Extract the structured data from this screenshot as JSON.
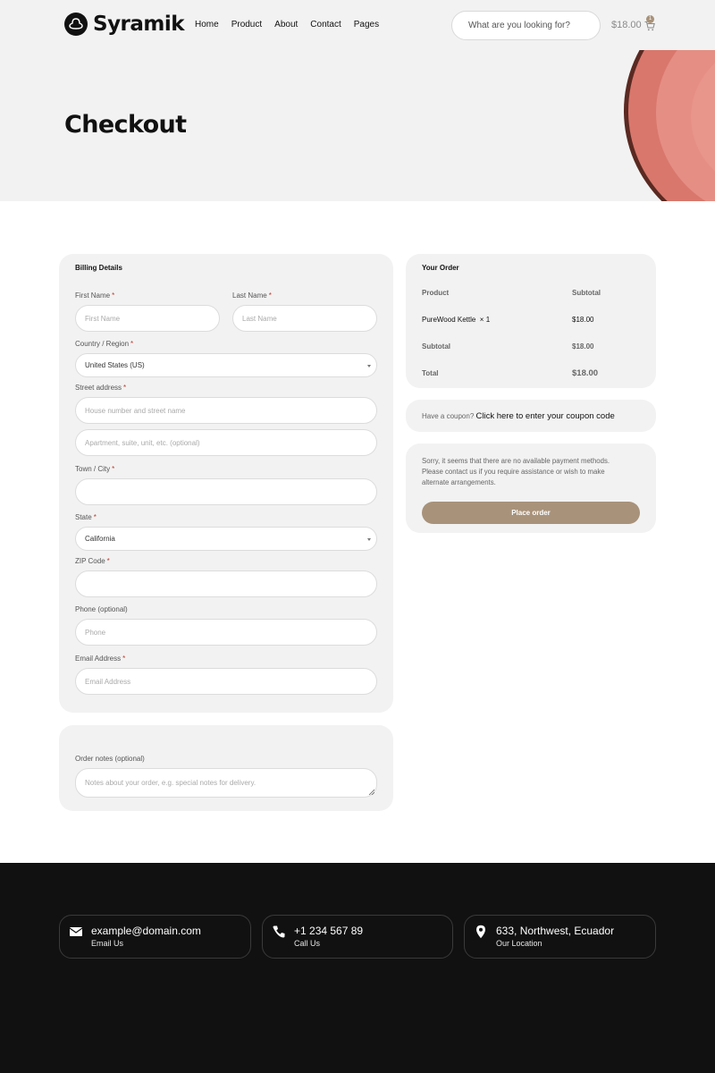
{
  "header": {
    "logo_text": "Syramik",
    "nav": [
      "Home",
      "Product",
      "About",
      "Contact",
      "Pages"
    ],
    "search_placeholder": "What are you looking for?",
    "cart_total": "$18.00",
    "cart_count": "1"
  },
  "hero": {
    "title": "Checkout"
  },
  "billing": {
    "title": "Billing Details",
    "first_name": {
      "label": "First Name",
      "placeholder": "First Name"
    },
    "last_name": {
      "label": "Last Name",
      "placeholder": "Last Name"
    },
    "country": {
      "label": "Country / Region",
      "value": "United States (US)"
    },
    "street": {
      "label": "Street address",
      "placeholder": "House number and street name",
      "placeholder2": "Apartment, suite, unit, etc. (optional)"
    },
    "town": {
      "label": "Town / City",
      "value": ""
    },
    "state": {
      "label": "State",
      "value": "California"
    },
    "zip": {
      "label": "ZIP Code",
      "value": ""
    },
    "phone": {
      "label": "Phone (optional)",
      "placeholder": "Phone"
    },
    "email": {
      "label": "Email Address",
      "placeholder": "Email Address"
    },
    "required_mark": "*"
  },
  "notes": {
    "label": "Order notes (optional)",
    "placeholder": "Notes about your order, e.g. special notes for delivery."
  },
  "order": {
    "title": "Your Order",
    "col_product": "Product",
    "col_subtotal": "Subtotal",
    "item_name": "PureWood Kettle",
    "item_qty": "× 1",
    "item_price": "$18.00",
    "subtotal_label": "Subtotal",
    "subtotal_value": "$18.00",
    "total_label": "Total",
    "total_value": "$18.00"
  },
  "coupon": {
    "prompt": "Have a coupon?",
    "link": "Click here to enter your coupon code"
  },
  "payment": {
    "message": "Sorry, it seems that there are no available payment methods. Please contact us if you require assistance or wish to make alternate arrangements.",
    "place_order": "Place order"
  },
  "footer": {
    "email": {
      "value": "example@domain.com",
      "label": "Email Us",
      "icon": "envelope-icon"
    },
    "phone": {
      "value": "+1 234 567 89",
      "label": "Call Us",
      "icon": "phone-icon"
    },
    "location": {
      "value": "633, Northwest, Ecuador",
      "label": "Our Location",
      "icon": "map-pin-icon"
    }
  },
  "colors": {
    "accent": "#a8927a",
    "hero_bg": "#f2f2f2",
    "footer_bg": "#111111",
    "plate": "#e0847a"
  }
}
